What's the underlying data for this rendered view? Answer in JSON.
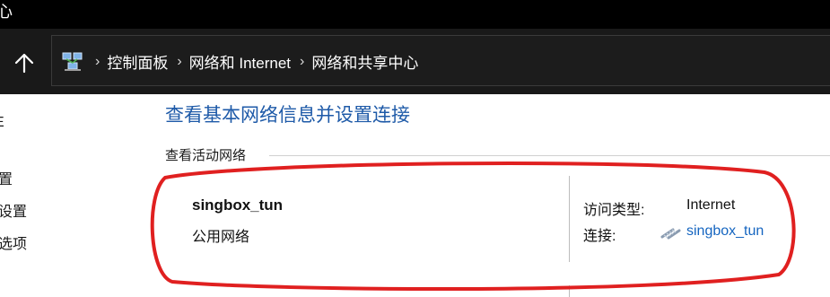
{
  "window": {
    "title_fragment": "心"
  },
  "address_bar": {
    "crumbs": [
      "控制面板",
      "网络和 Internet",
      "网络和共享中心"
    ],
    "separator": "›"
  },
  "left_nav": {
    "items": [
      "置",
      "设置",
      "选项"
    ],
    "partial_glyph": "E"
  },
  "main": {
    "title": "查看基本网络信息并设置连接",
    "active_networks_header": "查看活动网络",
    "network": {
      "name": "singbox_tun",
      "type": "公用网络"
    },
    "access_type": {
      "label": "访问类型:",
      "value": "Internet"
    },
    "connection": {
      "label": "连接:",
      "value": "singbox_tun"
    }
  },
  "colors": {
    "title_blue": "#1e5aa8",
    "link_blue": "#1565c0",
    "annotation_red": "#e02020",
    "address_bg": "#191919"
  },
  "icons": [
    "arrow-up-icon",
    "network-center-icon",
    "ethernet-connection-icon"
  ]
}
